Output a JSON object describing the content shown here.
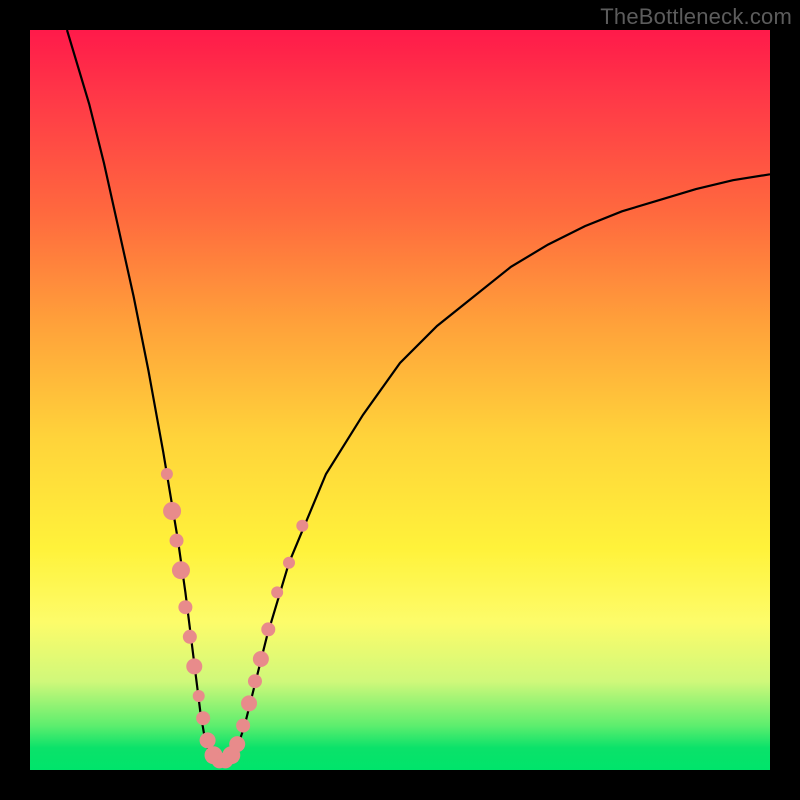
{
  "watermark": "TheBottleneck.com",
  "colors": {
    "curve_stroke": "#000000",
    "marker_fill": "#e88b8b",
    "marker_stroke": "#cf7a7a",
    "gradient_top": "#ff1a4a",
    "gradient_bottom": "#00e46b",
    "frame_bg": "#000000"
  },
  "chart_data": {
    "type": "line",
    "title": "",
    "xlabel": "",
    "ylabel": "",
    "xlim": [
      0,
      100
    ],
    "ylim": [
      0,
      100
    ],
    "series": [
      {
        "name": "bottleneck-curve",
        "x": [
          5,
          8,
          10,
          12,
          14,
          16,
          18,
          19,
          20,
          21,
          22,
          22.5,
          23,
          23.5,
          24,
          24.5,
          25,
          26,
          27,
          28,
          29,
          30,
          32,
          35,
          40,
          45,
          50,
          55,
          60,
          65,
          70,
          75,
          80,
          85,
          90,
          95,
          100
        ],
        "y": [
          100,
          90,
          82,
          73,
          64,
          54,
          43,
          37,
          31,
          24,
          16,
          12,
          8,
          5,
          3,
          2,
          1.5,
          1.2,
          1.5,
          3,
          6,
          10,
          18,
          28,
          40,
          48,
          55,
          60,
          64,
          68,
          71,
          73.5,
          75.5,
          77,
          78.5,
          79.7,
          80.5
        ]
      }
    ],
    "markers": [
      {
        "x": 18.5,
        "y": 40,
        "r": 6
      },
      {
        "x": 19.2,
        "y": 35,
        "r": 9
      },
      {
        "x": 19.8,
        "y": 31,
        "r": 7
      },
      {
        "x": 20.4,
        "y": 27,
        "r": 9
      },
      {
        "x": 21.0,
        "y": 22,
        "r": 7
      },
      {
        "x": 21.6,
        "y": 18,
        "r": 7
      },
      {
        "x": 22.2,
        "y": 14,
        "r": 8
      },
      {
        "x": 22.8,
        "y": 10,
        "r": 6
      },
      {
        "x": 23.4,
        "y": 7,
        "r": 7
      },
      {
        "x": 24.0,
        "y": 4,
        "r": 8
      },
      {
        "x": 24.8,
        "y": 2,
        "r": 9
      },
      {
        "x": 25.6,
        "y": 1.3,
        "r": 8
      },
      {
        "x": 26.4,
        "y": 1.3,
        "r": 8
      },
      {
        "x": 27.2,
        "y": 2,
        "r": 9
      },
      {
        "x": 28.0,
        "y": 3.5,
        "r": 8
      },
      {
        "x": 28.8,
        "y": 6,
        "r": 7
      },
      {
        "x": 29.6,
        "y": 9,
        "r": 8
      },
      {
        "x": 30.4,
        "y": 12,
        "r": 7
      },
      {
        "x": 31.2,
        "y": 15,
        "r": 8
      },
      {
        "x": 32.2,
        "y": 19,
        "r": 7
      },
      {
        "x": 33.4,
        "y": 24,
        "r": 6
      },
      {
        "x": 35.0,
        "y": 28,
        "r": 6
      },
      {
        "x": 36.8,
        "y": 33,
        "r": 6
      }
    ]
  }
}
